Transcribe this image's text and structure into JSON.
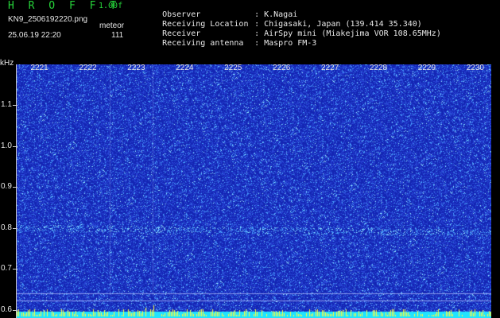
{
  "header": {
    "app_title": "H R O F F T",
    "version": "1.00f",
    "filename": "KN9_2506192220.png",
    "mode": "meteor",
    "datetime": "25.06.19 22:20",
    "count": "111"
  },
  "station_info": [
    {
      "label": "Observer",
      "value": "K.Nagai"
    },
    {
      "label": "Receiving Location",
      "value": "Chigasaki, Japan (139.414 35.340)"
    },
    {
      "label": "Receiver",
      "value": "AirSpy mini (Miakejima VOR 108.65MHz)"
    },
    {
      "label": "Receiving antenna",
      "value": "Maspro FM-3"
    }
  ],
  "chart_data": {
    "type": "heatmap",
    "ylabel": "kHz",
    "y_ticks": [
      "1.1",
      "1.0",
      "0.9",
      "0.8",
      "0.7",
      "0.6"
    ],
    "x_ticks": [
      "2221",
      "2222",
      "2223",
      "2224",
      "2225",
      "2226",
      "2227",
      "2228",
      "2229",
      "2230"
    ],
    "ylim": [
      0.58,
      1.2
    ],
    "xlim": [
      2220.5,
      2230.3
    ],
    "carrier_khz": 0.795,
    "colors": {
      "background": "#1426b4",
      "noise_low": "#2a46d8",
      "noise_mid": "#4aa4ff",
      "noise_high": "#9ff0ff",
      "bottom_band": "#21e4ff",
      "spike": "#ffff3c"
    }
  }
}
